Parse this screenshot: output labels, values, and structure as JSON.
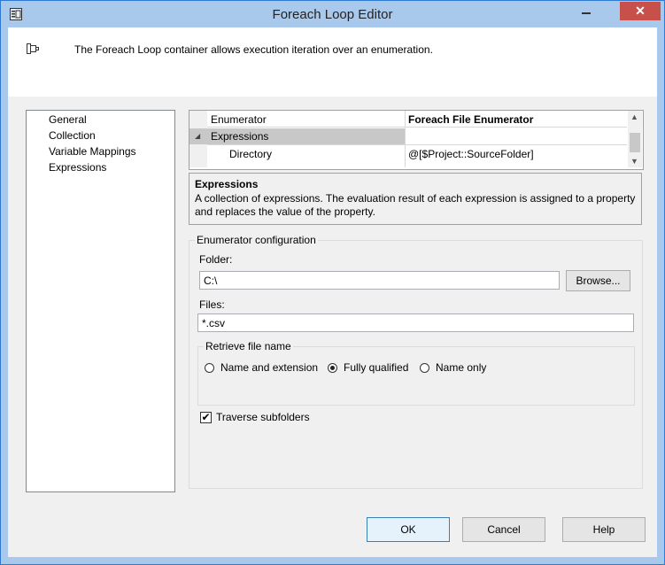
{
  "window": {
    "title": "Foreach Loop Editor",
    "close_glyph": "✕"
  },
  "header": {
    "description": "The Foreach Loop container allows execution iteration over an enumeration."
  },
  "nav": {
    "items": [
      "General",
      "Collection",
      "Variable Mappings",
      "Expressions"
    ]
  },
  "property_grid": {
    "rows": [
      {
        "name": "Enumerator",
        "value": "Foreach File Enumerator"
      },
      {
        "name": "Expressions",
        "value": ""
      },
      {
        "name": "Directory",
        "value": "@[$Project::SourceFolder]"
      }
    ],
    "expand_glyph": "◢"
  },
  "help": {
    "title": "Expressions",
    "text": "A collection of expressions. The evaluation result of each expression is assigned to a property and replaces the value of the property."
  },
  "enumerator_config": {
    "caption": "Enumerator configuration",
    "folder_label": "Folder:",
    "folder_value": "C:\\",
    "browse_label": "Browse...",
    "files_label": "Files:",
    "files_value": "*.csv",
    "retrieve_caption": "Retrieve file name",
    "radio_options": [
      "Name and extension",
      "Fully qualified",
      "Name only"
    ],
    "selected_option": "Fully qualified",
    "traverse_label": "Traverse subfolders",
    "traverse_checked": true,
    "check_glyph": "✔"
  },
  "buttons": {
    "ok": "OK",
    "cancel": "Cancel",
    "help": "Help"
  }
}
